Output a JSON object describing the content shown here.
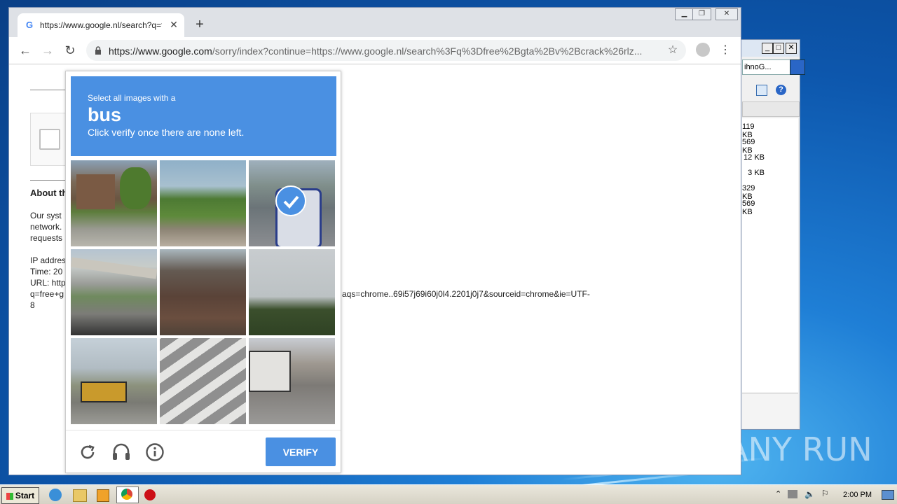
{
  "background_window": {
    "search_text": "ihnoG...",
    "file_sizes": [
      "119 KB",
      "569 KB",
      "12 KB",
      "3 KB",
      "329 KB",
      "569 KB"
    ]
  },
  "browser": {
    "tab_title": "https://www.google.nl/search?q=fr",
    "url_host": "https://www.google.com",
    "url_path": "/sorry/index?continue=https://www.google.nl/search%3Fq%3Dfree%2Bgta%2Bv%2Bcrack%26rlz..."
  },
  "page": {
    "about_heading": "About th",
    "para1": [
      "Our syst",
      "network.",
      "requests"
    ],
    "info_lines": [
      "IP addres",
      "Time: 20",
      "URL: http",
      "q=free+g",
      "8"
    ],
    "url_tail": "aqs=chrome..69i57j69i60j0l4.2201j0j7&sourceid=chrome&ie=UTF-"
  },
  "captcha": {
    "instruction_small": "Select all images with a",
    "target": "bus",
    "instruction_sub": "Click verify once there are none left.",
    "verify_label": "VERIFY",
    "tiles": [
      {
        "name": "tile-house-street",
        "selected": false
      },
      {
        "name": "tile-trees-road",
        "selected": false
      },
      {
        "name": "tile-bus-front",
        "selected": true
      },
      {
        "name": "tile-overpass",
        "selected": false
      },
      {
        "name": "tile-brick-house",
        "selected": false
      },
      {
        "name": "tile-pine-trees",
        "selected": false
      },
      {
        "name": "tile-school-bus",
        "selected": false
      },
      {
        "name": "tile-crosswalk",
        "selected": false
      },
      {
        "name": "tile-bus-street",
        "selected": false
      }
    ]
  },
  "taskbar": {
    "start_label": "Start",
    "clock": "2:00 PM"
  },
  "watermark": "ANY RUN"
}
